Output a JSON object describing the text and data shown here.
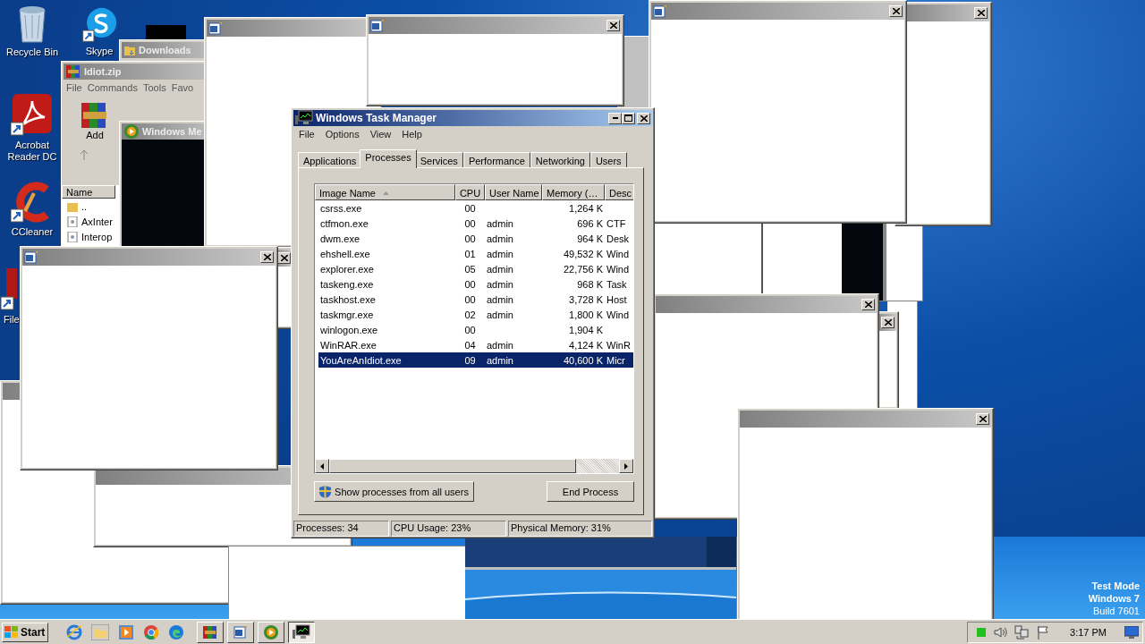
{
  "desktop": {
    "icons": [
      {
        "kind": "bin",
        "label": "Recycle Bin"
      },
      {
        "kind": "skype",
        "label": "Skype"
      },
      {
        "kind": "acrobat",
        "label": "Acrobat Reader DC"
      },
      {
        "kind": "ccleaner",
        "label": "CCleaner"
      },
      {
        "kind": "file",
        "label": "File"
      }
    ],
    "watermark": [
      "Test Mode",
      "Windows 7",
      "Build 7601"
    ]
  },
  "background_windows": {
    "downloads": {
      "title": "Downloads"
    },
    "winrar": {
      "title": "Idiot.zip",
      "menu": [
        "File",
        "Commands",
        "Tools",
        "Favo"
      ],
      "toolbar": [
        "Add"
      ],
      "column": "Name",
      "files": [
        "..",
        "AxInter",
        "Interop"
      ]
    },
    "media_player": {
      "title": "Windows Me"
    }
  },
  "task_manager": {
    "title": "Windows Task Manager",
    "menu": [
      "File",
      "Options",
      "View",
      "Help"
    ],
    "tabs": [
      {
        "label": "Applications",
        "selected": false
      },
      {
        "label": "Processes",
        "selected": true
      },
      {
        "label": "Services",
        "selected": false
      },
      {
        "label": "Performance",
        "selected": false
      },
      {
        "label": "Networking",
        "selected": false
      },
      {
        "label": "Users",
        "selected": false
      }
    ],
    "columns": [
      "Image Name",
      "CPU",
      "User Name",
      "Memory (…",
      "Desc"
    ],
    "rows": [
      {
        "cells": [
          "csrss.exe",
          "00",
          "",
          "1,264 K",
          ""
        ],
        "selected": false
      },
      {
        "cells": [
          "ctfmon.exe",
          "00",
          "admin",
          "696 K",
          "CTF"
        ],
        "selected": false
      },
      {
        "cells": [
          "dwm.exe",
          "00",
          "admin",
          "964 K",
          "Desk"
        ],
        "selected": false
      },
      {
        "cells": [
          "ehshell.exe",
          "01",
          "admin",
          "49,532 K",
          "Wind"
        ],
        "selected": false
      },
      {
        "cells": [
          "explorer.exe",
          "05",
          "admin",
          "22,756 K",
          "Wind"
        ],
        "selected": false
      },
      {
        "cells": [
          "taskeng.exe",
          "00",
          "admin",
          "968 K",
          "Task"
        ],
        "selected": false
      },
      {
        "cells": [
          "taskhost.exe",
          "00",
          "admin",
          "3,728 K",
          "Host"
        ],
        "selected": false
      },
      {
        "cells": [
          "taskmgr.exe",
          "02",
          "admin",
          "1,800 K",
          "Wind"
        ],
        "selected": false
      },
      {
        "cells": [
          "winlogon.exe",
          "00",
          "",
          "1,904 K",
          ""
        ],
        "selected": false
      },
      {
        "cells": [
          "WinRAR.exe",
          "04",
          "admin",
          "4,124 K",
          "WinR"
        ],
        "selected": false
      },
      {
        "cells": [
          "YouAreAnIdiot.exe",
          "09",
          "admin",
          "40,600 K",
          "Micr"
        ],
        "selected": true
      }
    ],
    "show_all_button": "Show processes from all users",
    "end_button": "End Process",
    "status_bar": [
      "Processes: 34",
      "CPU Usage: 23%",
      "Physical Memory: 31%"
    ]
  },
  "taskbar": {
    "start": "Start",
    "quick_launch": [
      {
        "kind": "ie"
      },
      {
        "kind": "folder"
      },
      {
        "kind": "media"
      },
      {
        "kind": "chrome"
      },
      {
        "kind": "edge"
      }
    ],
    "tasks": [
      {
        "kind": "winrar",
        "selected": false
      },
      {
        "kind": "word",
        "selected": false
      },
      {
        "kind": "wmp",
        "selected": false
      },
      {
        "kind": "taskmgr",
        "selected": true
      }
    ],
    "tray": [
      {
        "kind": "green"
      },
      {
        "kind": "speaker"
      },
      {
        "kind": "network"
      },
      {
        "kind": "flag"
      }
    ],
    "clock": "3:17 PM"
  }
}
